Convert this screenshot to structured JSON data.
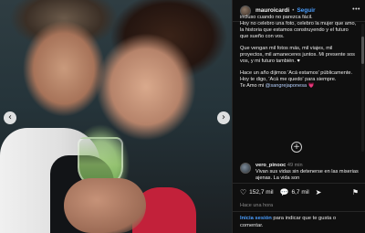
{
  "post": {
    "username": "mauroicardi",
    "separator": "•",
    "follow_label": "Seguir",
    "more_label": "•••",
    "caption_lines": [
      "incluso cuando no parezca fácil.\nHoy no celebro una foto, celebro la mujer que amo, la historia que estamos construyendo y el futuro que sueño con vos.",
      "Que vengan mil fotos más, mil viajes, mil proyectos, mil amaneceres juntos. Mi presente sos vos, y mi futuro también. ♥",
      "Hace un año dijimos 'Acá estamos' públicamente.\nHoy te digo, 'Acá me quedo' para siempre. "
    ],
    "signoff_prefix": "Te Amo mi ",
    "signoff_mention": "@sangrejaponesa",
    "signoff_suffix": " 💗",
    "plus_label": "+",
    "comment": {
      "user": "vero_pinooc",
      "time": "49 min",
      "text": "Vivan sus vidas sin detenerse en las miserias ajenas. La vida son"
    },
    "likes": "152,7 mil",
    "comments_count": "6,7 mil",
    "date": "Hace una hora",
    "login_link": "Inicia sesión",
    "login_text": " para indicar que te gusta o comentar."
  },
  "icons": {
    "prev": "‹",
    "next": "›",
    "heart": "♡",
    "comment": "💬",
    "share": "➤",
    "bookmark": "⚑"
  }
}
